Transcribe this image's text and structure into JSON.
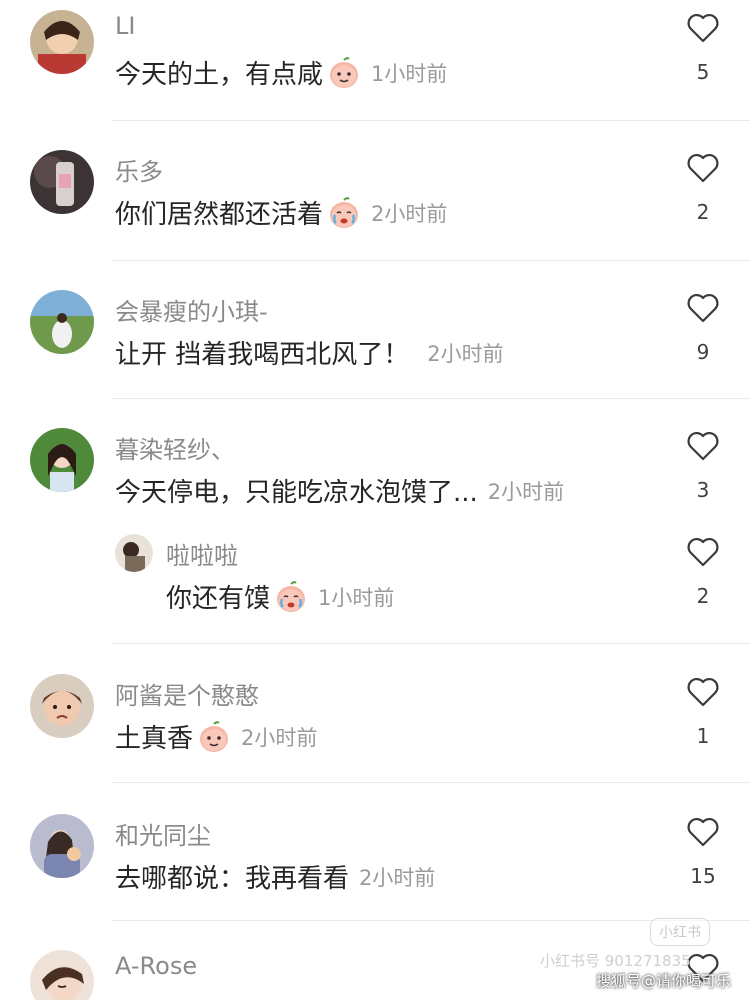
{
  "comments": [
    {
      "username": "LI",
      "text": "今天的土，有点咸",
      "emoji": "smiling-peach-emoji",
      "time": "1小时前",
      "likes": "5"
    },
    {
      "username": "乐多",
      "text": "你们居然都还活着",
      "emoji": "crying-peach-emoji",
      "time": "2小时前",
      "likes": "2"
    },
    {
      "username": "会暴瘦的小琪-",
      "text": "让开 挡着我喝西北风了！",
      "time": "2小时前",
      "likes": "9"
    },
    {
      "username": "暮染轻纱、",
      "text": "今天停电，只能吃凉水泡馍了...",
      "time": "2小时前",
      "likes": "3"
    },
    {
      "username": "啦啦啦",
      "text": "你还有馍",
      "emoji": "crying-peach-emoji",
      "time": "1小时前",
      "likes": "2"
    },
    {
      "username": "阿酱是个憨憨",
      "text": "土真香",
      "emoji": "smiling-peach-emoji",
      "time": "2小时前",
      "likes": "1"
    },
    {
      "username": "和光同尘",
      "text": "去哪都说：我再看看",
      "time": "2小时前",
      "likes": "15"
    },
    {
      "username": "A-Rose"
    }
  ],
  "watermark": {
    "badge": "小红书",
    "id_text": "小红书号 901271835",
    "sohu": "搜狐号@请你喝可乐"
  },
  "colors": {
    "username": "#8a8a8a",
    "text": "#262626",
    "time": "#9a9a9a",
    "heart": "#3a3a3a",
    "divider": "#e9e9e9"
  }
}
